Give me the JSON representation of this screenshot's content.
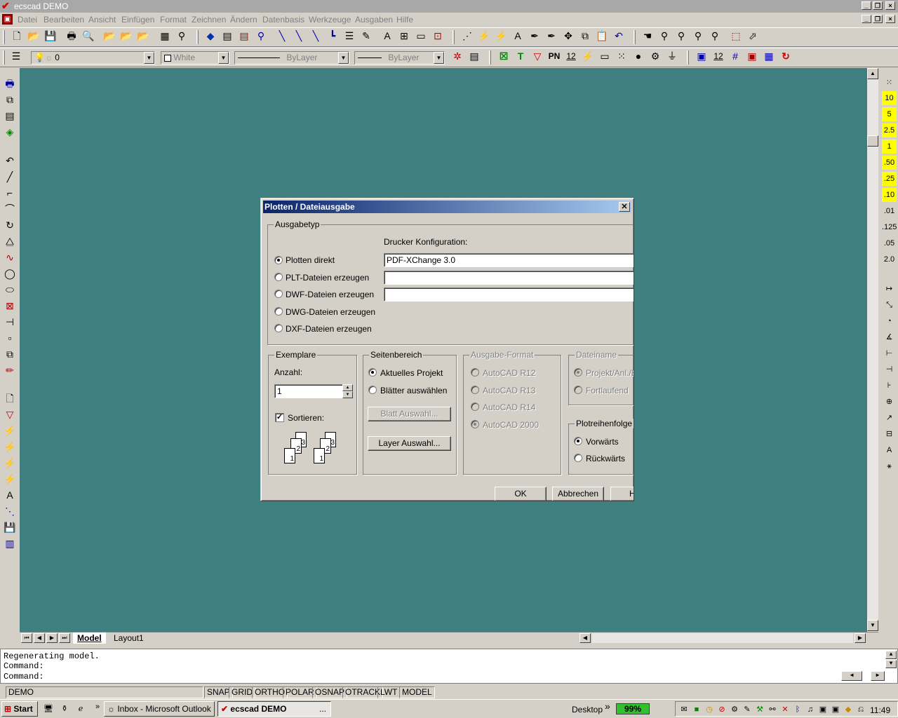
{
  "window": {
    "title": "ecscad  DEMO"
  },
  "menu": [
    "Datei",
    "Bearbeiten",
    "Ansicht",
    "Einfügen",
    "Format",
    "Zeichnen",
    "Ändern",
    "Datenbasis",
    "Werkzeuge",
    "Ausgaben",
    "Hilfe"
  ],
  "props": {
    "layer": "0",
    "color": "White",
    "linetype": "ByLayer",
    "lineweight": "ByLayer",
    "pn_label": "PN",
    "num_label": "12"
  },
  "scale_buttons": [
    "10",
    "5",
    "2.5",
    "1",
    ".50",
    ".25",
    ".10",
    ".01",
    ".125",
    ".05",
    "2.0"
  ],
  "tabs": {
    "model": "Model",
    "layout": "Layout1"
  },
  "command": {
    "lines": [
      "Regenerating model.",
      "Command:",
      "Command:"
    ]
  },
  "status": {
    "demo": "DEMO",
    "toggles": [
      "SNAP",
      "GRID",
      "ORTHO",
      "POLAR",
      "OSNAP",
      "OTRACK",
      "LWT",
      "MODEL"
    ]
  },
  "taskbar": {
    "start": "Start",
    "outlook": "Inbox - Microsoft Outlook",
    "ecscad": "ecscad  DEMO",
    "ellipsis": "...",
    "desktop": "Desktop",
    "battery": "99%",
    "clock": "11:49"
  },
  "dialog": {
    "title": "Plotten / Dateiausgabe",
    "ausgabetyp": {
      "label": "Ausgabetyp",
      "printer_label": "Drucker Konfiguration:",
      "options": [
        "Plotten direkt",
        "PLT-Dateien erzeugen",
        "DWF-Dateien erzeugen",
        "DWG-Dateien erzeugen",
        "DXF-Dateien erzeugen"
      ],
      "printer_value": "PDF-XChange 3.0"
    },
    "exemplare": {
      "label": "Exemplare",
      "anzahl_label": "Anzahl:",
      "anzahl": "1",
      "sortieren": "Sortieren:"
    },
    "seitenbereich": {
      "label": "Seitenbereich",
      "options": [
        "Aktuelles Projekt",
        "Blätter auswählen"
      ],
      "blatt_button": "Blatt Auswahl...",
      "layer_button": "Layer Auswahl..."
    },
    "ausgabeformat": {
      "label": "Ausgabe-Format",
      "options": [
        "AutoCAD R12",
        "AutoCAD R13",
        "AutoCAD R14",
        "AutoCAD 2000"
      ]
    },
    "dateiname": {
      "label": "Dateiname",
      "options": [
        "Projekt/Anl./B",
        "Fortlaufend"
      ]
    },
    "reihenfolge": {
      "label": "Plotreihenfolge",
      "options": [
        "Vorwärts",
        "Rückwärts"
      ]
    },
    "buttons": {
      "ok": "OK",
      "cancel": "Abbrechen",
      "help": "H"
    }
  }
}
